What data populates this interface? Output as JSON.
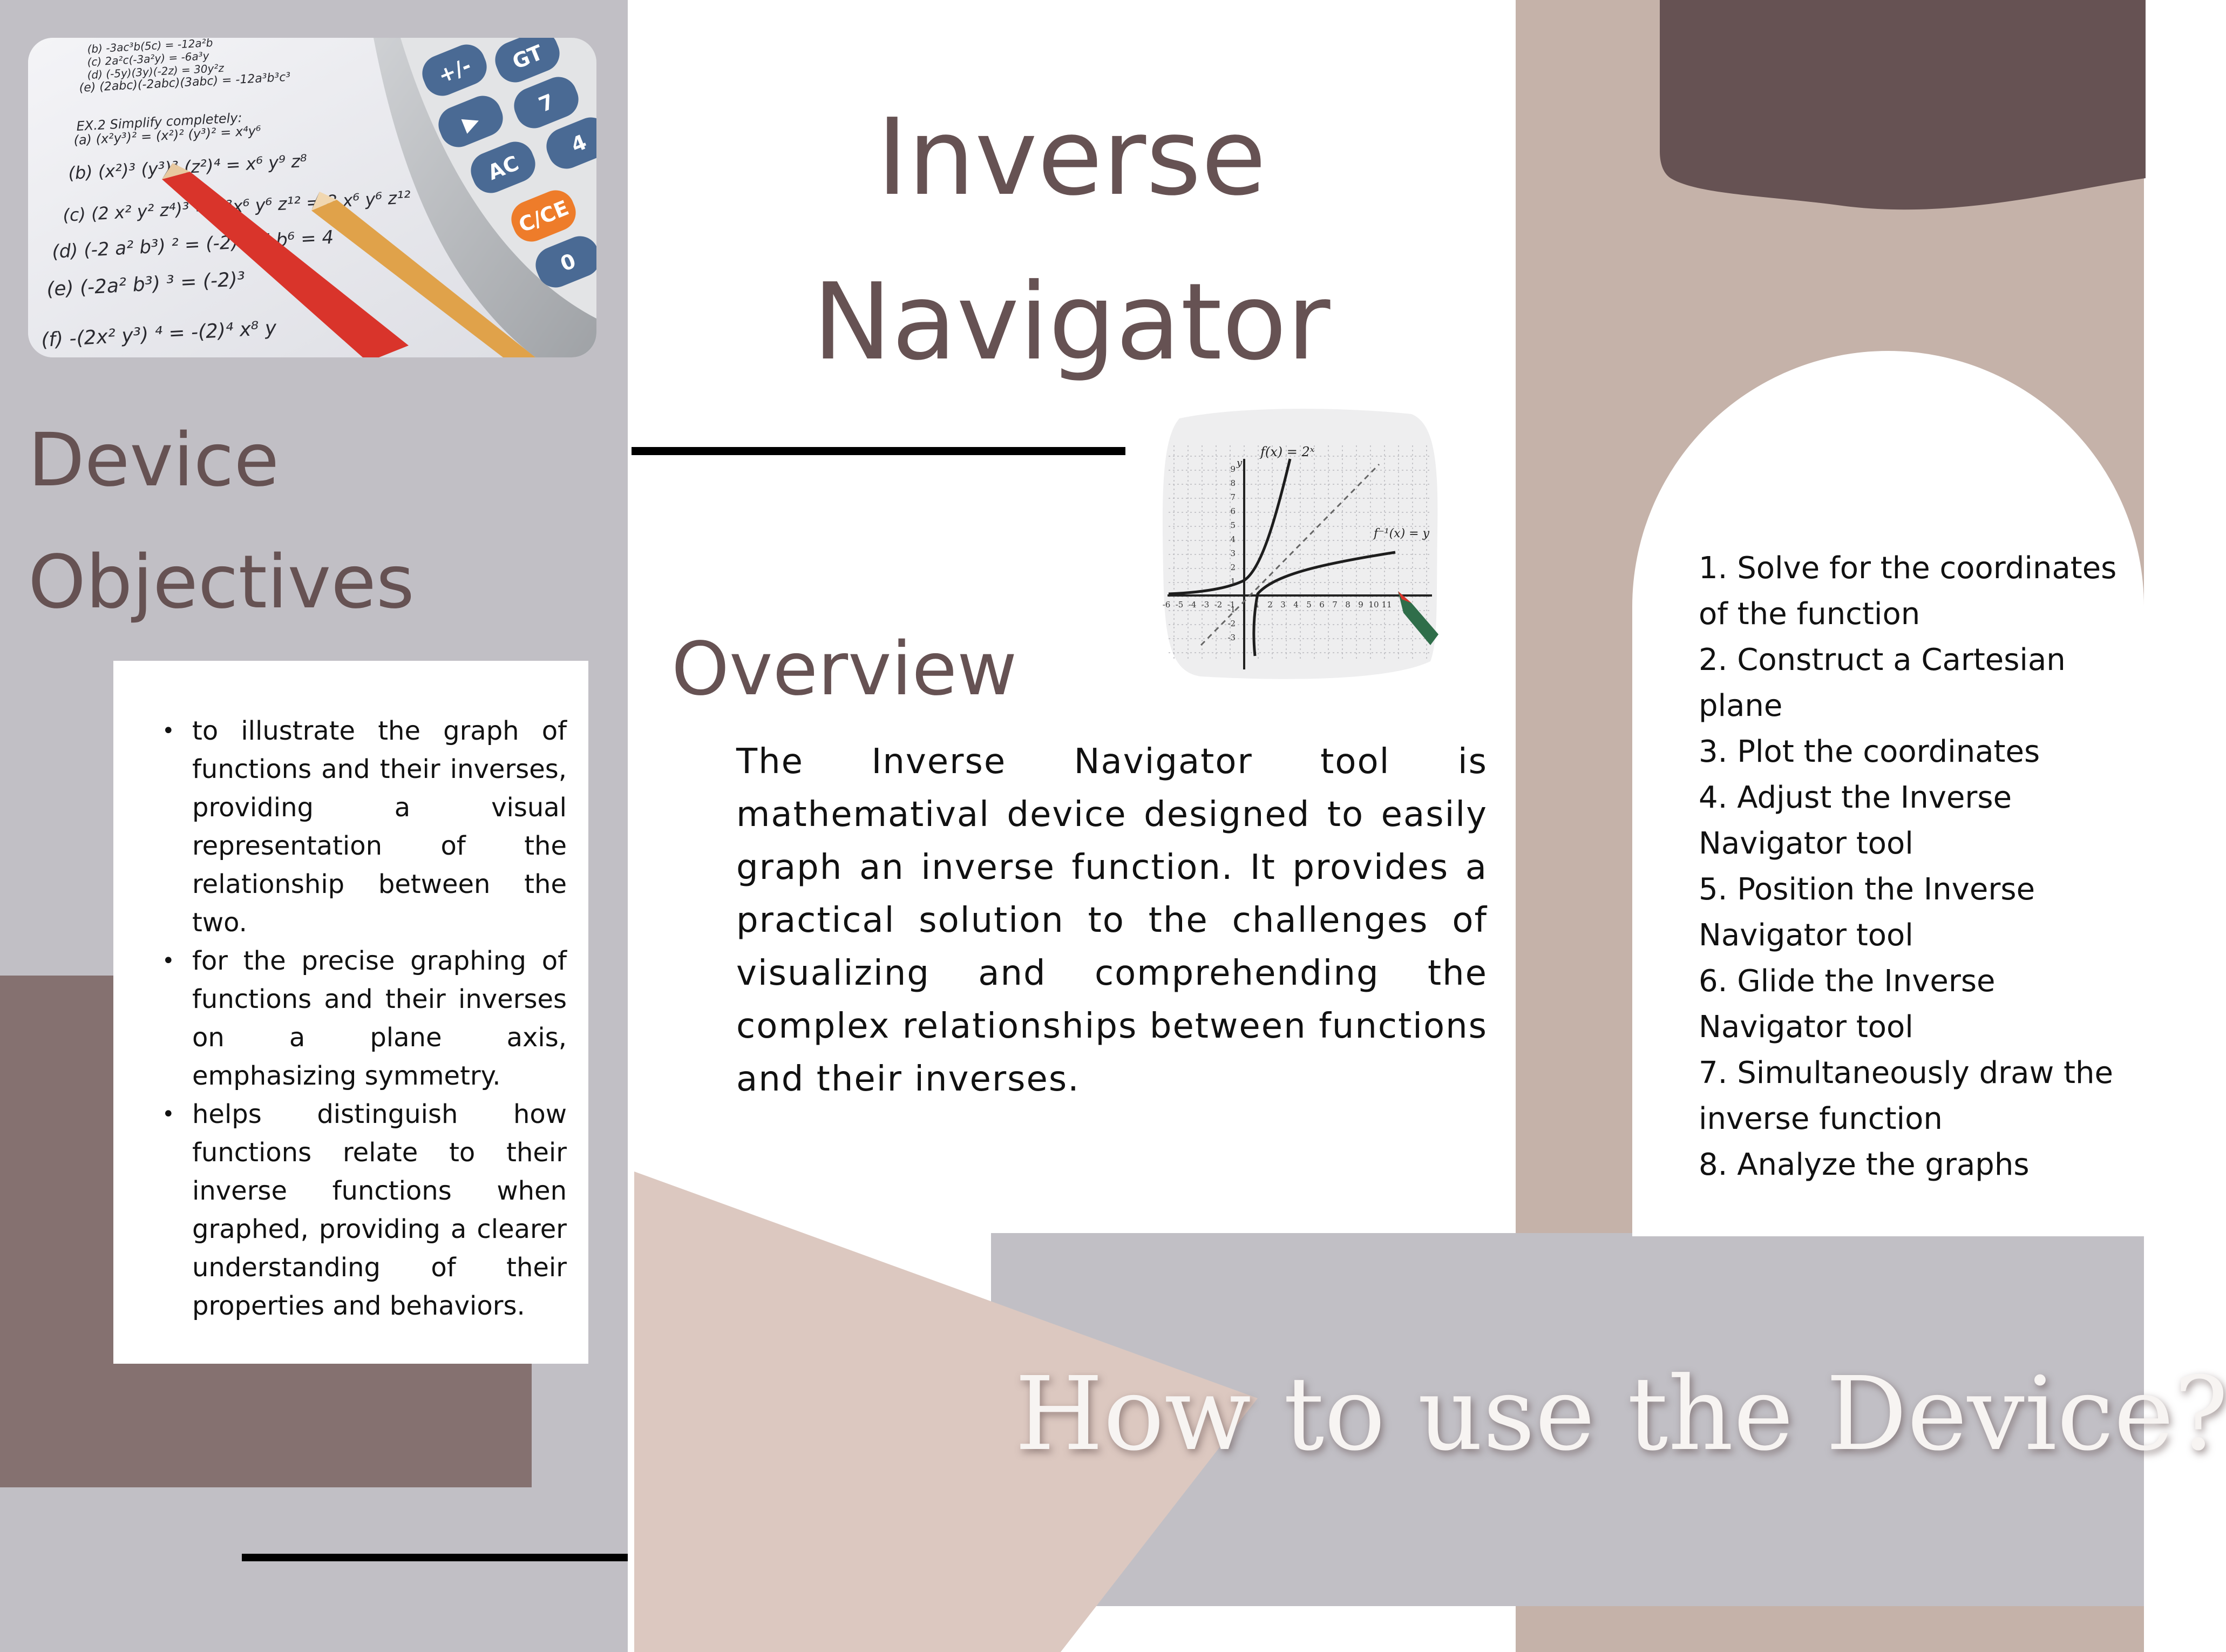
{
  "title": "Inverse Navigator",
  "device_objectives": {
    "heading": "Device Objectives",
    "items": [
      "to illustrate the graph of functions and their inverses, providing a visual representation of the relationship between the two.",
      "for the precise graphing of functions and their inverses on a plane axis, emphasizing symmetry.",
      "helps distinguish how functions relate to their inverse functions when graphed, providing a clearer understanding of their properties and behaviors."
    ]
  },
  "overview": {
    "heading": "Overview",
    "body": "The Inverse Navigator tool is mathematival device designed to easily graph an inverse function. It provides a practical solution to the challenges of visualizing and comprehending the complex relationships between functions and their inverses."
  },
  "how_to": {
    "heading": "How to use the Device?",
    "steps": [
      "1. Solve for the coordinates of the function",
      "2. Construct a Cartesian plane",
      "3. Plot the coordinates",
      "4. Adjust the Inverse Navigator tool",
      "5. Position the Inverse Navigator tool",
      "6. Glide the Inverse Navigator tool",
      "7. Simultaneously draw the inverse function",
      "8. Analyze the graphs"
    ]
  },
  "photo_calculator": {
    "worksheet_lines": [
      "(b) -3ac³b(5c) = -12a²b",
      "(c) 2a²c(-3a²y) = -6a³y",
      "(d) (-5y)(3y)(-2z) = 30y²z",
      "(e) (2abc)(-2abc)(3abc) = -12a³b³c³",
      "EX.2 Simplify completely:",
      "(a) (x²y³)² = (x²)² (y³)² = x⁴y⁶",
      "(b) (x²)³ (y³)³ (z²)⁴ = x⁶ y⁹ z⁸",
      "(c) (2 x² y² z⁴)³ = 2³x⁶ y⁶ z¹² = 8 x⁶ y⁶ z¹²",
      "(d) (-2 a² b³) ² = (-2)² a⁴ b⁶ = 4",
      "(e) (-2a² b³) ³ = (-2)³",
      "(f) -(2x² y³) ⁴ = -(2)⁴ x⁸ y"
    ],
    "keys": [
      "+/-",
      "GT",
      "▶",
      "7",
      "AC",
      "4",
      "C/CE",
      "0"
    ]
  },
  "photo_graph": {
    "label_function": "f(x) = 2ˣ",
    "label_inverse": "f⁻¹(x) = y",
    "axis_y": "y",
    "x_ticks": [
      "-6",
      "-5",
      "-4",
      "-3",
      "-2",
      "-1",
      "1",
      "2",
      "3",
      "4",
      "5",
      "6",
      "7",
      "8",
      "9",
      "10",
      "11"
    ],
    "y_ticks": [
      "9",
      "8",
      "7",
      "6",
      "5",
      "4",
      "3",
      "2",
      "1",
      "-1",
      "-2",
      "-3"
    ]
  },
  "colors": {
    "left_panel": "#c1bfc5",
    "mauve_block": "#857170",
    "heading_text": "#665253",
    "tan_strip": "#c5b2a9",
    "dark_blob": "#665253",
    "gray_banner": "#c1bfc5",
    "beige_triangle": "#dcc8c0"
  }
}
